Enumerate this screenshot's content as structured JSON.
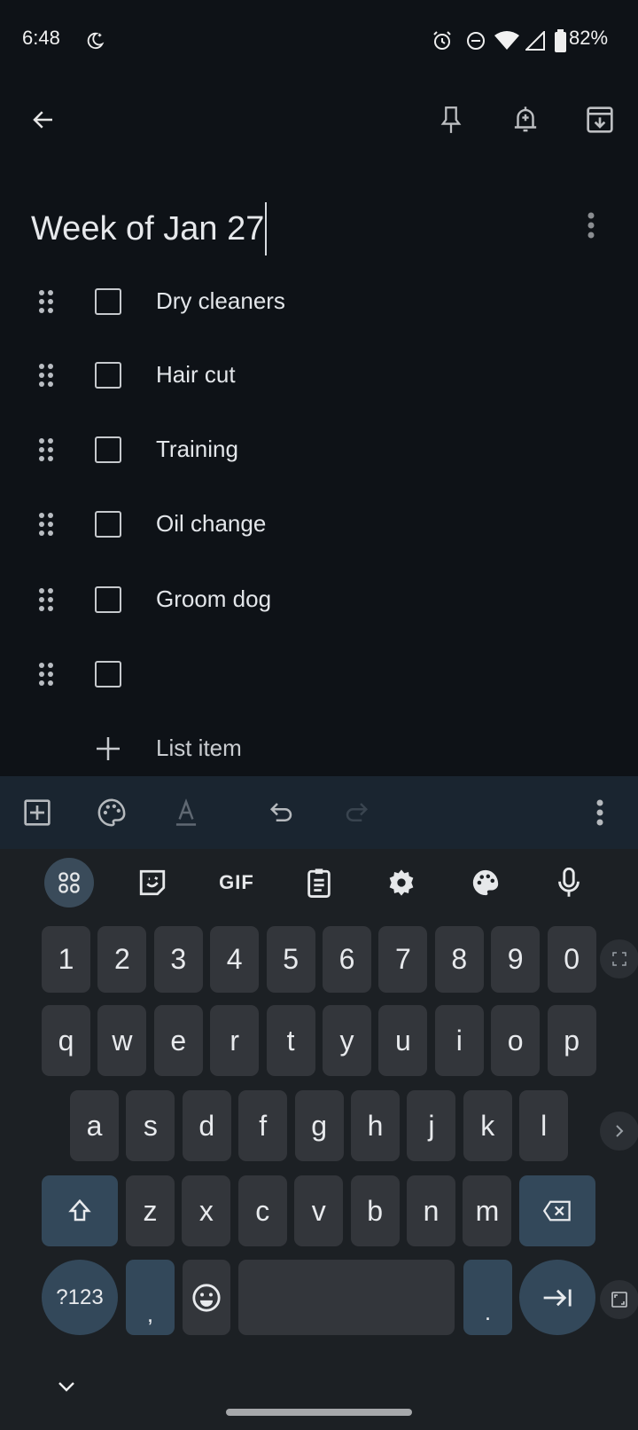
{
  "status_bar": {
    "time": "6:48",
    "battery": "82%",
    "icons": [
      "bedtime-icon",
      "alarm-icon",
      "dnd-icon",
      "wifi-icon",
      "signal-icon",
      "battery-icon"
    ]
  },
  "top_bar": {
    "icons": [
      "back-arrow-icon",
      "pin-icon",
      "reminder-bell-icon",
      "archive-icon"
    ]
  },
  "note": {
    "title": "Week of Jan 27",
    "items": [
      {
        "text": "Dry cleaners",
        "checked": false
      },
      {
        "text": "Hair cut",
        "checked": false
      },
      {
        "text": "Training",
        "checked": false
      },
      {
        "text": "Oil change",
        "checked": false
      },
      {
        "text": "Groom dog",
        "checked": false
      },
      {
        "text": "",
        "checked": false
      }
    ],
    "add_item_label": "List item"
  },
  "editor_toolbar": {
    "icons": [
      "add-box-icon",
      "palette-icon",
      "text-format-icon",
      "undo-icon",
      "redo-icon",
      "more-vert-icon"
    ]
  },
  "keyboard": {
    "suggestion_icons": [
      "apps-grid-icon",
      "sticker-icon",
      "gif-icon",
      "clipboard-icon",
      "settings-icon",
      "theme-palette-icon",
      "microphone-icon"
    ],
    "gif_label": "GIF",
    "rows": [
      [
        "1",
        "2",
        "3",
        "4",
        "5",
        "6",
        "7",
        "8",
        "9",
        "0"
      ],
      [
        "q",
        "w",
        "e",
        "r",
        "t",
        "y",
        "u",
        "i",
        "o",
        "p"
      ],
      [
        "a",
        "s",
        "d",
        "f",
        "g",
        "h",
        "j",
        "k",
        "l"
      ],
      [
        "z",
        "x",
        "c",
        "v",
        "b",
        "n",
        "m"
      ]
    ],
    "symbols_label": "?123",
    "comma": ",",
    "period": "."
  },
  "colors": {
    "background": "#0e1217",
    "toolbar": "#1a2530",
    "keyboard": "#1c2024",
    "key": "#33363b",
    "special_key": "#33485a"
  }
}
